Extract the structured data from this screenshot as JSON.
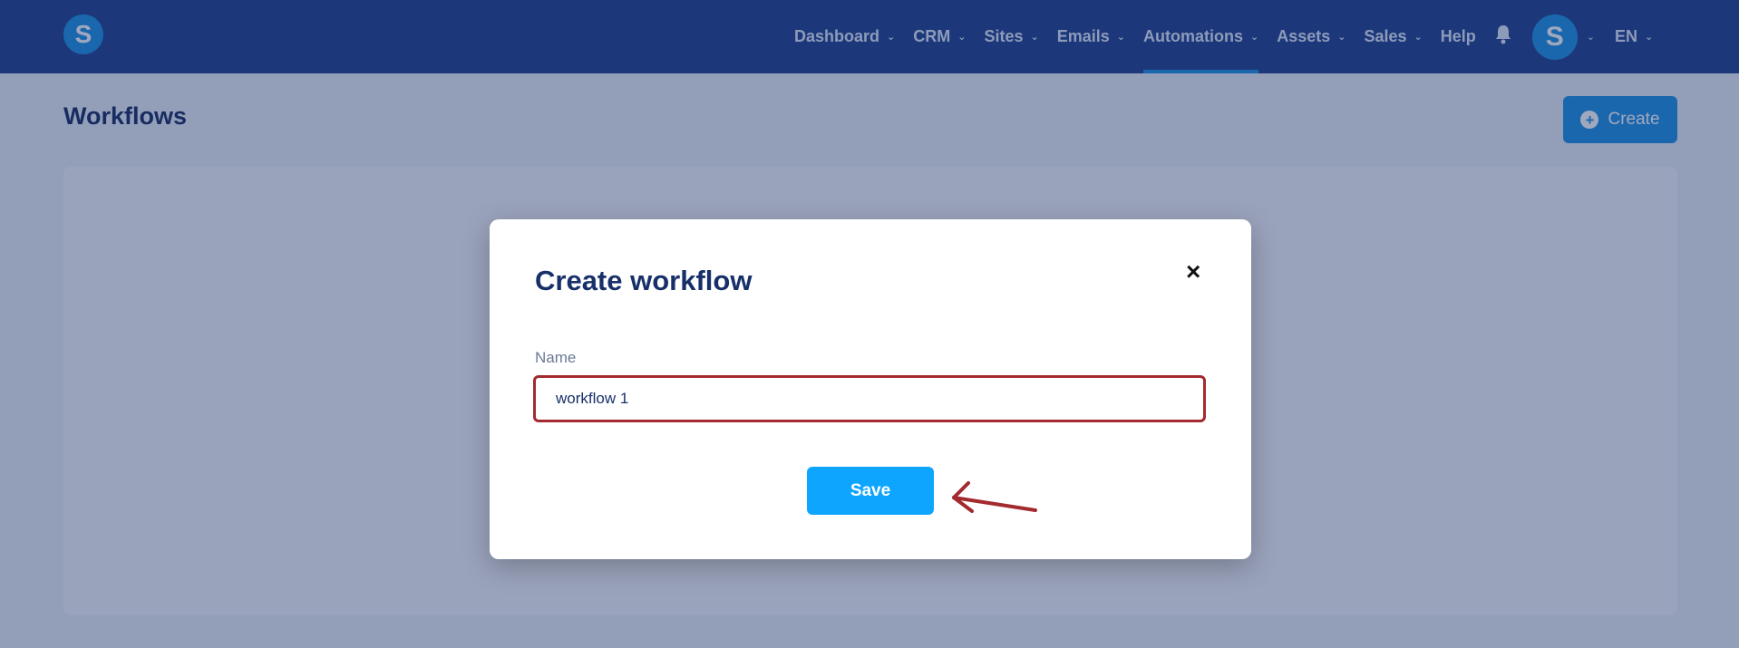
{
  "topbar": {
    "logo_letter": "S",
    "nav": [
      {
        "label": "Dashboard",
        "has_dropdown": true,
        "active": false
      },
      {
        "label": "CRM",
        "has_dropdown": true,
        "active": false
      },
      {
        "label": "Sites",
        "has_dropdown": true,
        "active": false
      },
      {
        "label": "Emails",
        "has_dropdown": true,
        "active": false
      },
      {
        "label": "Automations",
        "has_dropdown": true,
        "active": true
      },
      {
        "label": "Assets",
        "has_dropdown": true,
        "active": false
      },
      {
        "label": "Sales",
        "has_dropdown": true,
        "active": false
      },
      {
        "label": "Help",
        "has_dropdown": false,
        "active": false
      }
    ],
    "notification_icon": "bell-icon",
    "avatar_letter": "S",
    "language": "EN"
  },
  "page": {
    "title": "Workflows",
    "create_label": "Create"
  },
  "modal": {
    "title": "Create workflow",
    "close_glyph": "×",
    "name_label": "Name",
    "name_value": "workflow 1",
    "save_label": "Save"
  },
  "colors": {
    "topbar_bg": "#1d3f8c",
    "accent": "#1a8fe3",
    "save_button": "#0ea5ff",
    "input_highlight": "#a32a2e",
    "annotation_arrow": "#a32a2e"
  }
}
